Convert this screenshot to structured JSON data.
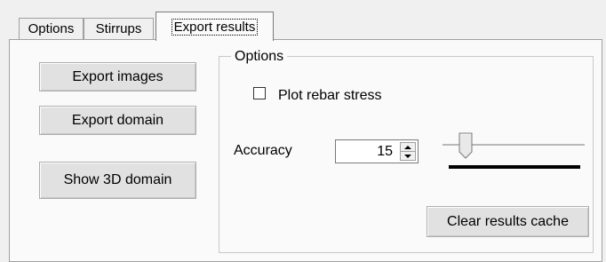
{
  "tabs": [
    {
      "label": "Options",
      "active": false
    },
    {
      "label": "Stirrups",
      "active": false
    },
    {
      "label": "Export results",
      "active": true
    }
  ],
  "actions": {
    "export_images": "Export images",
    "export_domain": "Export domain",
    "show_3d_domain": "Show 3D domain"
  },
  "options_group": {
    "title": "Options",
    "plot_rebar_stress": {
      "label": "Plot rebar stress",
      "checked": false
    },
    "accuracy": {
      "label": "Accuracy",
      "value": "15"
    },
    "clear_cache_label": "Clear results cache"
  }
}
